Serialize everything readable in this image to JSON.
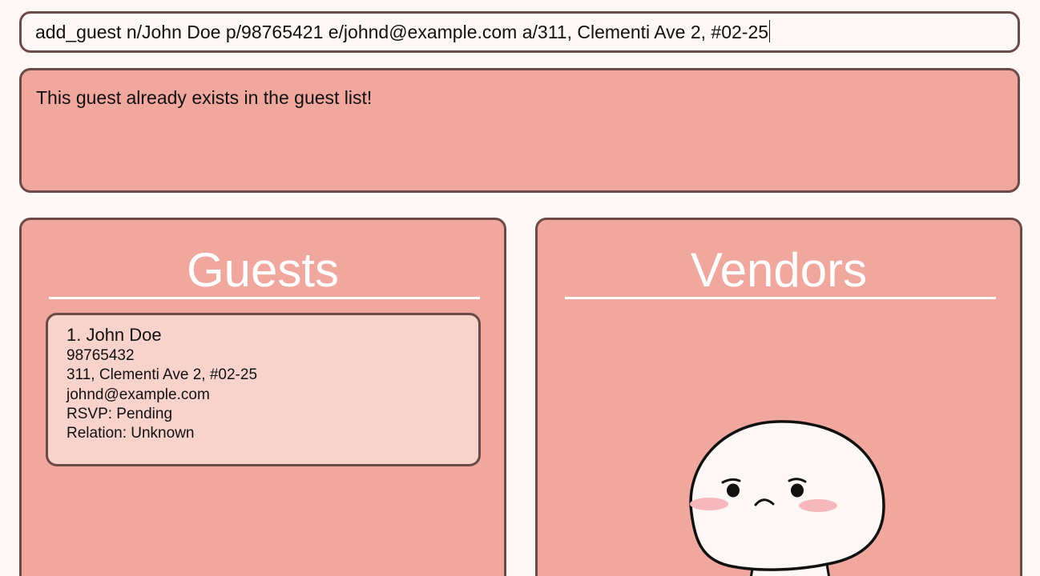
{
  "command": {
    "value": "add_guest n/John Doe p/98765421 e/johnd@example.com a/311, Clementi Ave 2, #02-25"
  },
  "result": {
    "message": "This guest already exists in the guest list!"
  },
  "guests": {
    "title": "Guests",
    "items": [
      {
        "name": "1. John Doe",
        "phone": "98765432",
        "address": "311, Clementi Ave 2, #02-25",
        "email": "johnd@example.com",
        "rsvp": "RSVP: Pending",
        "relation": "Relation: Unknown"
      }
    ]
  },
  "vendors": {
    "title": "Vendors",
    "empty_icon": "sad-mascot-icon"
  },
  "colors": {
    "background": "#fdf7f6",
    "panel": "#f0a79e",
    "card": "#f7d3cc",
    "border": "#6b4a47",
    "title": "#ffffff"
  }
}
